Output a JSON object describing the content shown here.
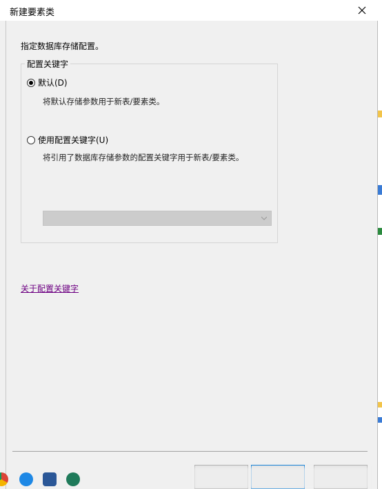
{
  "window": {
    "title": "新建要素类"
  },
  "main": {
    "instruction": "指定数据库存储配置。",
    "group_label": "配置关键字",
    "options": [
      {
        "label": "默认(D)",
        "description": "将默认存储参数用于新表/要素类。",
        "selected": true
      },
      {
        "label": "使用配置关键字(U)",
        "description": "将引用了数据库存储参数的配置关键字用于新表/要素类。",
        "selected": false
      }
    ],
    "keyword_dropdown": {
      "value": "",
      "enabled": false
    },
    "help_link": "关于配置关键字"
  },
  "footer": {
    "buttons": [
      {
        "label": ""
      },
      {
        "label": ""
      },
      {
        "label": ""
      }
    ]
  },
  "taskbar": {
    "icons": [
      "chrome-icon",
      "edge-icon",
      "word-icon",
      "search-app-icon"
    ]
  },
  "colors": {
    "window_bg": "#f0f0f0",
    "link": "#6d0082",
    "accent": "#0078d7"
  }
}
